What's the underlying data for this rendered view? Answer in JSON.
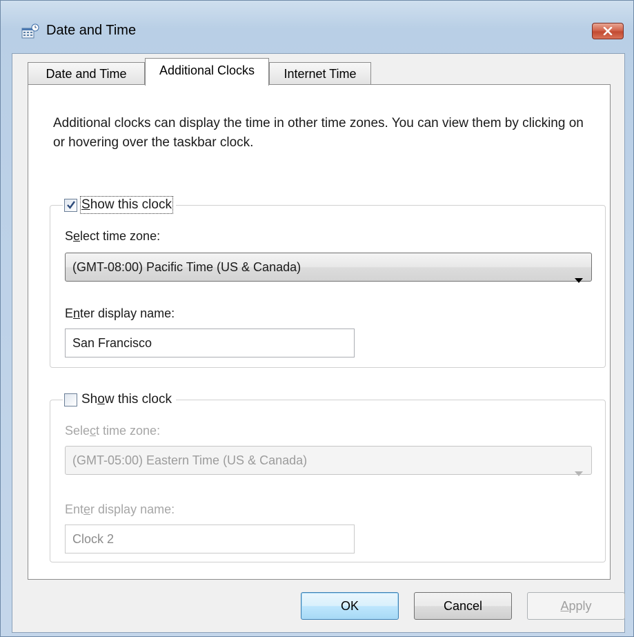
{
  "window": {
    "title": "Date and Time",
    "icon": "date-time-icon",
    "close_icon": "close-icon"
  },
  "tabs": [
    {
      "label": "Date and Time",
      "active": false
    },
    {
      "label": "Additional Clocks",
      "active": true
    },
    {
      "label": "Internet Time",
      "active": false
    }
  ],
  "description": "Additional clocks can display the time in other time zones. You can view them by clicking on or hovering over the taskbar clock.",
  "clock1": {
    "checked": true,
    "show_label_pre": "",
    "show_label_u": "S",
    "show_label_post": "how this clock",
    "tz_label_pre": "S",
    "tz_label_u": "e",
    "tz_label_post": "lect time zone:",
    "tz_value": "(GMT-08:00) Pacific Time (US & Canada)",
    "name_label_pre": "E",
    "name_label_u": "n",
    "name_label_post": "ter display name:",
    "name_value": "San Francisco"
  },
  "clock2": {
    "checked": false,
    "show_label_pre": "Sh",
    "show_label_u": "o",
    "show_label_post": "w this clock",
    "tz_label_pre": "Sele",
    "tz_label_u": "c",
    "tz_label_post": "t time zone:",
    "tz_value": "(GMT-05:00) Eastern Time (US & Canada)",
    "name_label_pre": "Ent",
    "name_label_u": "e",
    "name_label_post": "r display name:",
    "name_value": "Clock 2"
  },
  "buttons": {
    "ok": "OK",
    "cancel": "Cancel",
    "apply_u": "A",
    "apply_post": "pply"
  },
  "colors": {
    "titlebar": "#b9cfe6",
    "close": "#c24a32",
    "default_button": "#bee6fd"
  }
}
